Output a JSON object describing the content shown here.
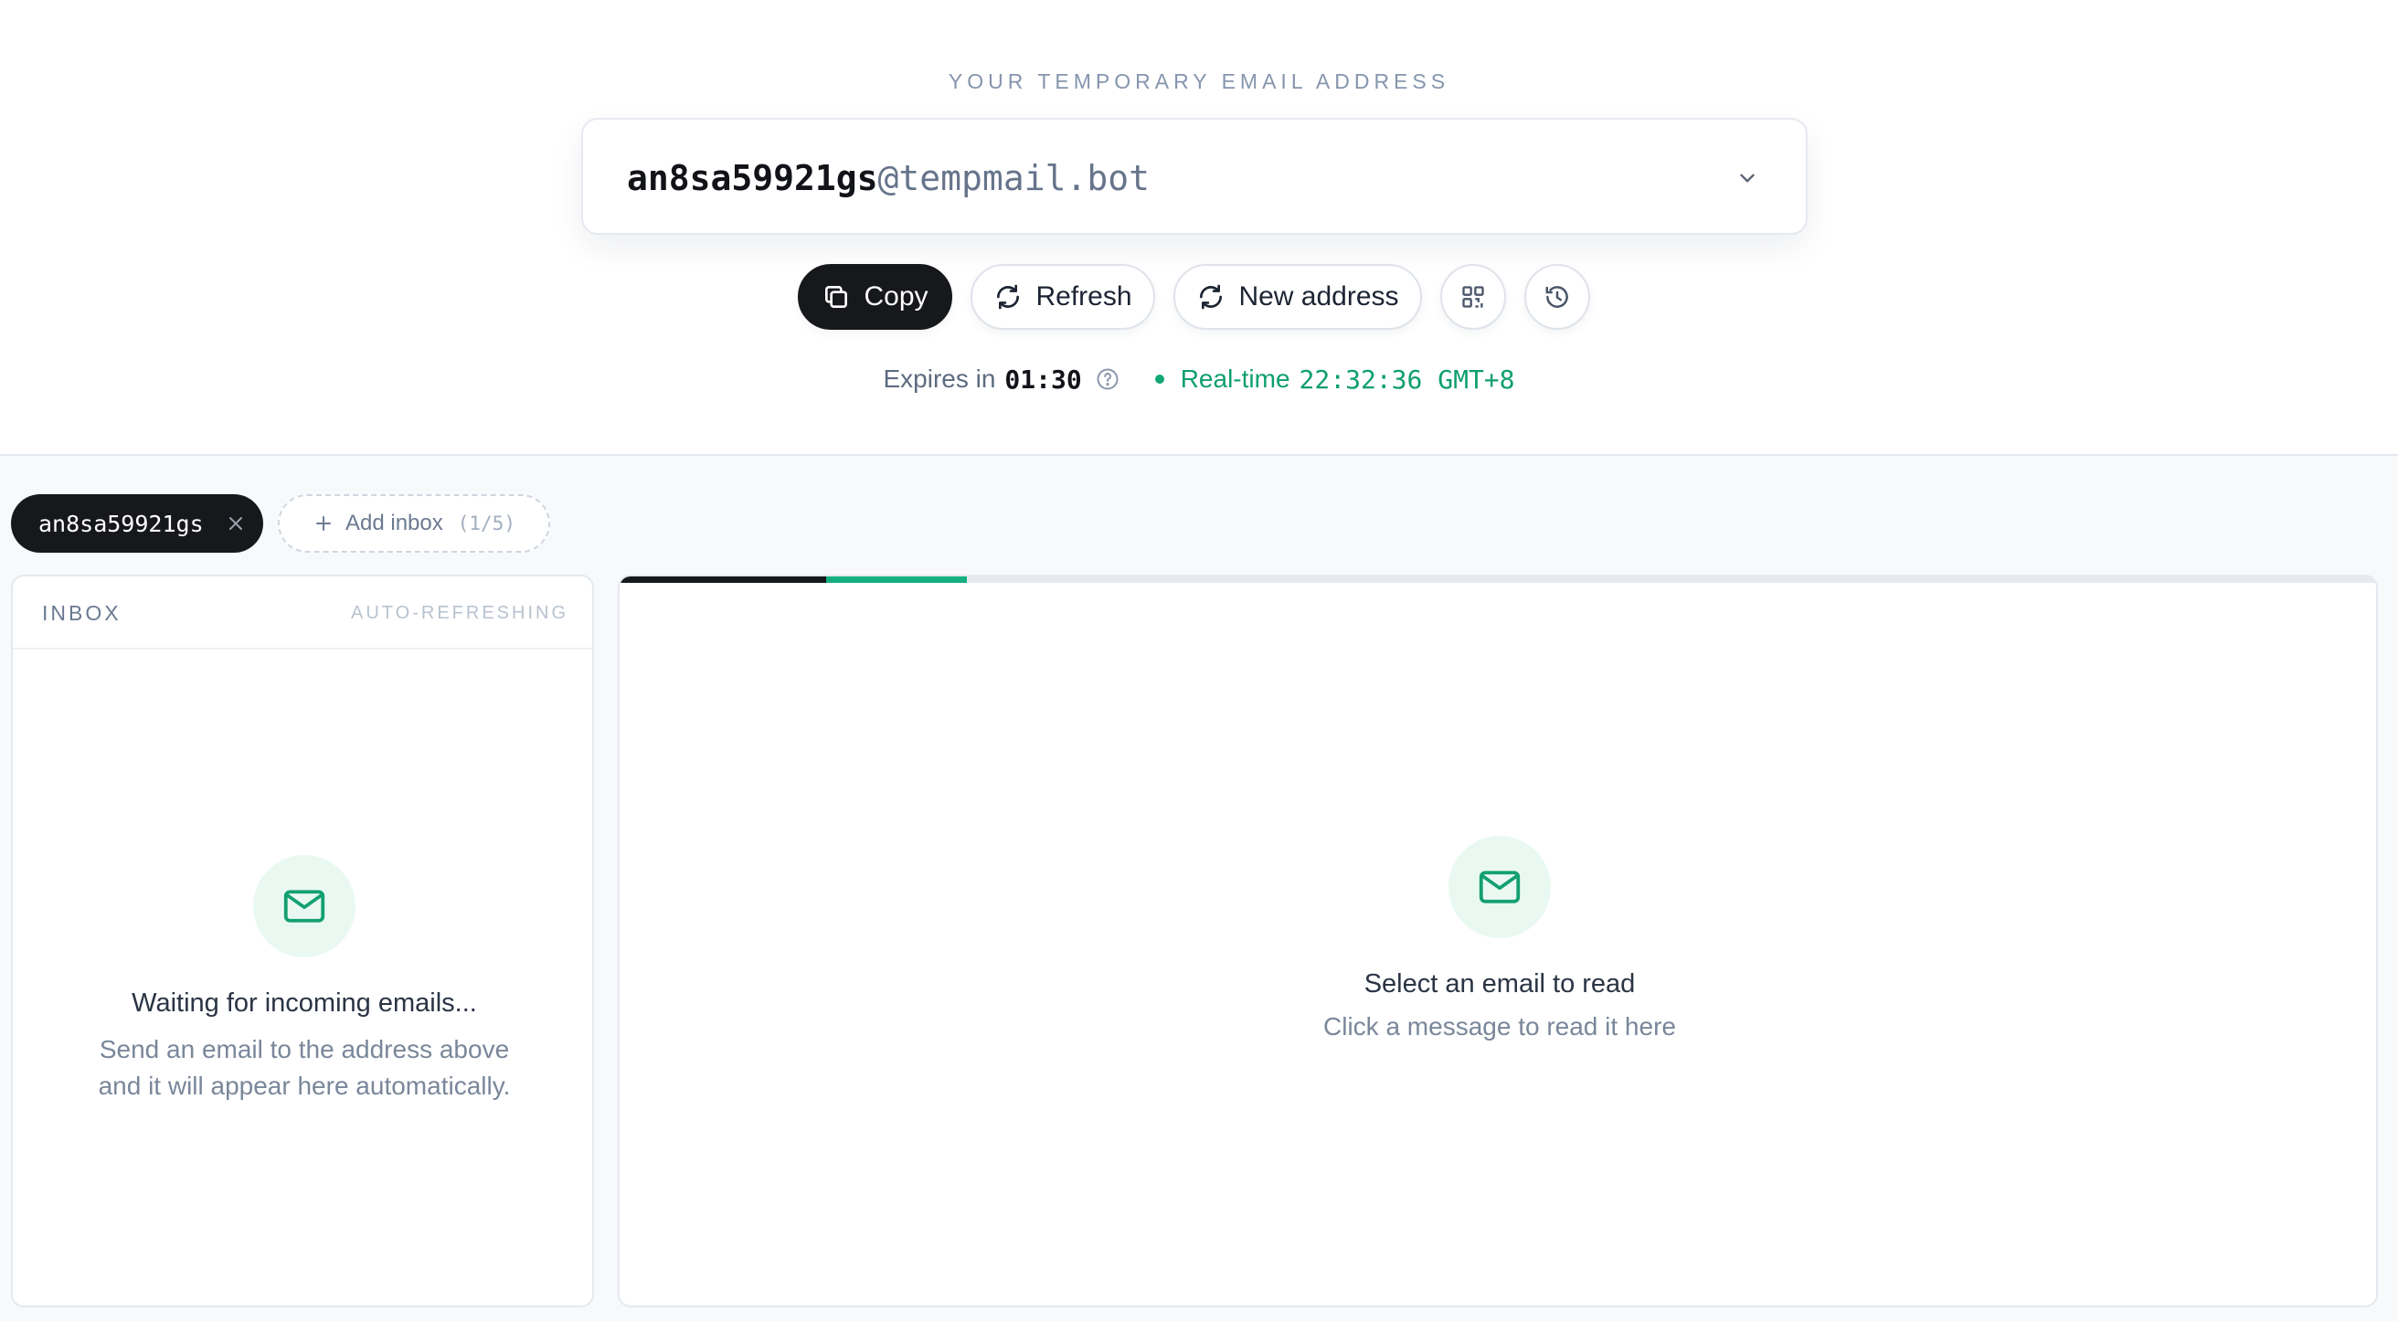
{
  "header": {
    "caption": "YOUR TEMPORARY EMAIL ADDRESS",
    "address_user": "an8sa59921gs",
    "address_domain": "@tempmail.bot"
  },
  "actions": {
    "copy_label": "Copy",
    "refresh_label": "Refresh",
    "new_address_label": "New address",
    "icons": [
      "copy-icon",
      "refresh-icon",
      "qr-code-icon",
      "history-icon"
    ]
  },
  "status": {
    "expires_label": "Expires in",
    "expires_time": "01:30",
    "realtime_label": "Real-time",
    "realtime_clock": "22:32:36 GMT+8"
  },
  "tabs": {
    "active_inbox": "an8sa59921gs",
    "add_inbox_label": "Add inbox",
    "add_inbox_count": "(1/5)"
  },
  "inbox": {
    "title": "INBOX",
    "auto_label": "AUTO-REFRESHING",
    "empty_title": "Waiting for incoming emails...",
    "empty_line1": "Send an email to the address above",
    "empty_line2": "and it will appear here automatically."
  },
  "reader": {
    "empty_title": "Select an email to read",
    "empty_sub": "Click a message to read it here"
  },
  "colors": {
    "accent_green": "#13a873",
    "dark": "#17181b",
    "muted": "#8595ad"
  }
}
